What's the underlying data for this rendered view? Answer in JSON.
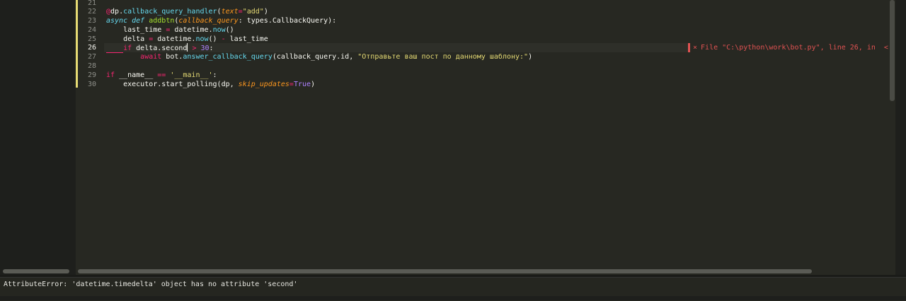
{
  "editor": {
    "line_numbers": [
      "21",
      "22",
      "23",
      "24",
      "25",
      "26",
      "27",
      "28",
      "29",
      "30"
    ],
    "active_line": "26",
    "lines": {
      "l22": {
        "at": "@",
        "dp": "dp.",
        "fn": "callback_query_handler",
        "open": "(",
        "param": "text",
        "eq": "=",
        "str": "\"add\"",
        "close": ")"
      },
      "l23": {
        "async": "async",
        "def": "def",
        "name": "addbtn",
        "open": "(",
        "param": "callback_query",
        "rest": ": types.CallbackQuery):"
      },
      "l24": {
        "pre": "last_time ",
        "eq": "=",
        "mid": " datetime.",
        "fn": "now",
        "post": "()"
      },
      "l25": {
        "pre": "delta ",
        "eq": "=",
        "mid": " datetime.",
        "fn": "now",
        "post": "() ",
        "minus": "-",
        "tail": " last_time"
      },
      "l26": {
        "kw": "if",
        "mid": " delta.second",
        "gt": " >",
        "num": " 30",
        "post": ":"
      },
      "l27": {
        "await": "await",
        "mid": " bot.",
        "fn": "answer_callback_query",
        "pre_str": "(callback_query.id, ",
        "str": "\"Отправьте ваш пост по данному шаблону:\"",
        "post": ")"
      },
      "l29": {
        "kw": "if",
        "mid": " __name__ ",
        "eq": "==",
        "str": " '__main__'",
        "post": ":"
      },
      "l30": {
        "pre": "executor.start_polling(dp, ",
        "param": "skip_updates",
        "eq": "=",
        "const": "True",
        "post": ")"
      }
    },
    "error_annotation": {
      "icon": "×",
      "text": "File \"C:\\python\\work\\bot.py\", line 26, in  <"
    }
  },
  "output": {
    "message": "AttributeError: 'datetime.timedelta' object has no attribute 'second'"
  },
  "colors": {
    "background": "#272822",
    "error": "#e05252"
  }
}
